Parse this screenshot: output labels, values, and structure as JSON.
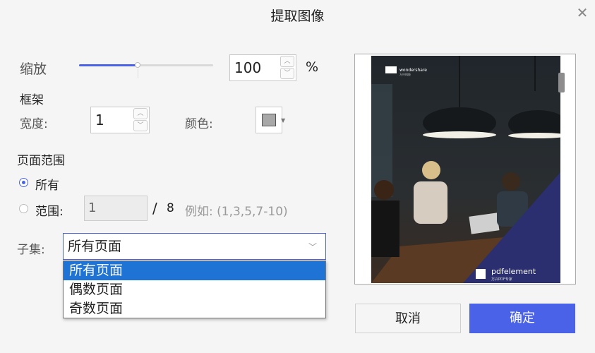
{
  "dialog": {
    "title": "提取图像",
    "close_icon": "close-icon"
  },
  "zoom": {
    "label": "缩放",
    "value": "100",
    "unit": "%",
    "slider_level_percent": 43
  },
  "frame": {
    "heading": "框架",
    "width_label": "宽度:",
    "width_value": "1",
    "color_label": "颜色:",
    "color_value": "#a8a8a8"
  },
  "page_range": {
    "heading": "页面范围",
    "option_all": "所有",
    "option_range": "范围:",
    "range_value": "1",
    "separator": "/",
    "total_pages": "8",
    "example": "例如: (1,3,5,7-10)",
    "selected": "all"
  },
  "subset": {
    "label": "子集:",
    "selected": "所有页面",
    "options": [
      "所有页面",
      "偶数页面",
      "奇数页面"
    ]
  },
  "preview": {
    "brand": "wondershare",
    "brand_sub": "万兴科技",
    "product": "pdfelement",
    "product_sub": "万兴PDF专家"
  },
  "buttons": {
    "cancel": "取消",
    "ok": "确定"
  },
  "colors": {
    "accent": "#4a62e8",
    "dropdown_highlight": "#1e73d4"
  }
}
